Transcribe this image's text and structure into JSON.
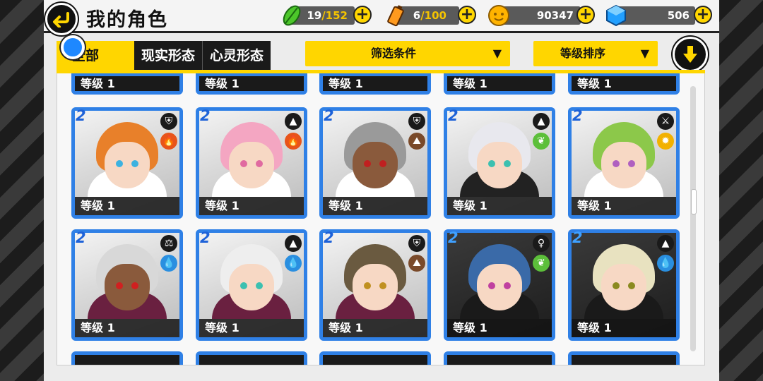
{
  "header": {
    "title": "我的角色",
    "resources": [
      {
        "name": "stamina",
        "icon": "green-feather-icon",
        "current": "19",
        "max": "/152"
      },
      {
        "name": "battery",
        "icon": "battery-icon",
        "current": "6",
        "max": "/100"
      },
      {
        "name": "coins",
        "icon": "gold-coin-icon",
        "current": "90347"
      },
      {
        "name": "gems",
        "icon": "blue-gem-icon",
        "current": "506"
      }
    ]
  },
  "tabs": [
    "全部",
    "现实形态",
    "心灵形态"
  ],
  "filters": {
    "filter_label": "筛选条件",
    "sort_label": "等级排序",
    "arrow": "▼"
  },
  "top_row_level": "等级 1",
  "cards": [
    {
      "star": "2",
      "level": "等级 1",
      "badge1": "⛨",
      "badge2": "🔥",
      "badge2_color": "#e8541a",
      "hair": "#e8802a",
      "skin": "light",
      "eyes": "#3cb2e0",
      "cloth": "#ffffff",
      "dark": false
    },
    {
      "star": "2",
      "level": "等级 1",
      "badge1": "▲",
      "badge2": "🔥",
      "badge2_color": "#e8541a",
      "hair": "#f4a6c2",
      "skin": "light",
      "eyes": "#e06aa0",
      "cloth": "#ffffff",
      "dark": false
    },
    {
      "star": "2",
      "level": "等级 1",
      "badge1": "⛨",
      "badge2": "⛰",
      "badge2_color": "#7a4a2a",
      "hair": "#9a9a9a",
      "skin": "tan",
      "eyes": "#c02020",
      "cloth": "#ffffff",
      "dark": false
    },
    {
      "star": "2",
      "level": "等级 1",
      "badge1": "▲",
      "badge2": "❦",
      "badge2_color": "#5cbf3a",
      "hair": "#e8e8ee",
      "skin": "light",
      "eyes": "#3cc0b0",
      "cloth": "#222222",
      "dark": false
    },
    {
      "star": "2",
      "level": "等级 1",
      "badge1": "⚔",
      "badge2": "✹",
      "badge2_color": "#f2b100",
      "hair": "#8cc84a",
      "skin": "light",
      "eyes": "#b060c0",
      "cloth": "#ffffff",
      "dark": false
    },
    {
      "star": "2",
      "level": "等级 1",
      "badge1": "⚖",
      "badge2": "💧",
      "badge2_color": "#2a8fe0",
      "hair": "#d8d8d8",
      "skin": "tan",
      "eyes": "#d02020",
      "cloth": "#6a2040",
      "dark": false
    },
    {
      "star": "2",
      "level": "等级 1",
      "badge1": "▲",
      "badge2": "💧",
      "badge2_color": "#2a8fe0",
      "hair": "#eeeeee",
      "skin": "light",
      "eyes": "#3cc0b0",
      "cloth": "#6a2040",
      "dark": false
    },
    {
      "star": "2",
      "level": "等级 1",
      "badge1": "⛨",
      "badge2": "⛰",
      "badge2_color": "#7a4a2a",
      "hair": "#6a5a40",
      "skin": "light",
      "eyes": "#c09020",
      "cloth": "#6a2040",
      "dark": false
    },
    {
      "star": "2",
      "level": "等级 1",
      "badge1": "♀",
      "badge2": "❦",
      "badge2_color": "#5cbf3a",
      "hair": "#3a6aa8",
      "skin": "light",
      "eyes": "#c040a0",
      "cloth": "#1a1a1a",
      "dark": true
    },
    {
      "star": "2",
      "level": "等级 1",
      "badge1": "▲",
      "badge2": "💧",
      "badge2_color": "#2a8fe0",
      "hair": "#e8e2c0",
      "skin": "light",
      "eyes": "#8a8a20",
      "cloth": "#1a1a1a",
      "dark": true
    }
  ],
  "colors": {
    "accent": "#ffd600",
    "card_border": "#2f80e6",
    "dark": "#1a1a1a"
  }
}
